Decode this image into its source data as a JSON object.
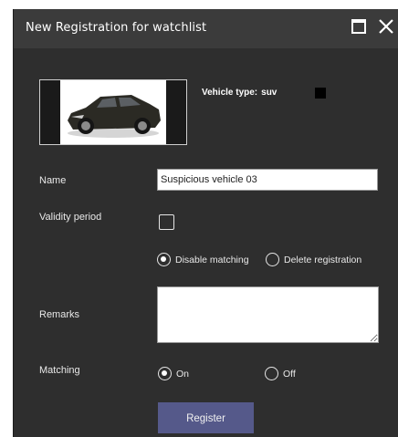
{
  "dialog": {
    "title": "New Registration for watchlist",
    "icons": {
      "maximize": "maximize-icon",
      "close": "close-icon"
    }
  },
  "vehicle": {
    "image": "vehicle-photo",
    "type_label": "Vehicle type:",
    "type_value": "suv",
    "color_swatch": "#000000"
  },
  "form": {
    "name_label": "Name",
    "name_value": "Suspicious vehicle 03",
    "validity_label": "Validity period",
    "validity_checked": false,
    "expiry_options": [
      {
        "label": "Disable matching",
        "selected": true
      },
      {
        "label": "Delete registration",
        "selected": false
      }
    ],
    "remarks_label": "Remarks",
    "remarks_value": "",
    "matching_label": "Matching",
    "matching_options": [
      {
        "label": "On",
        "selected": true
      },
      {
        "label": "Off",
        "selected": false
      }
    ],
    "register_label": "Register"
  },
  "colors": {
    "dialog_bg": "#2e2e2e",
    "titlebar_bg": "#3b3b3b",
    "button_bg": "#55598a"
  }
}
